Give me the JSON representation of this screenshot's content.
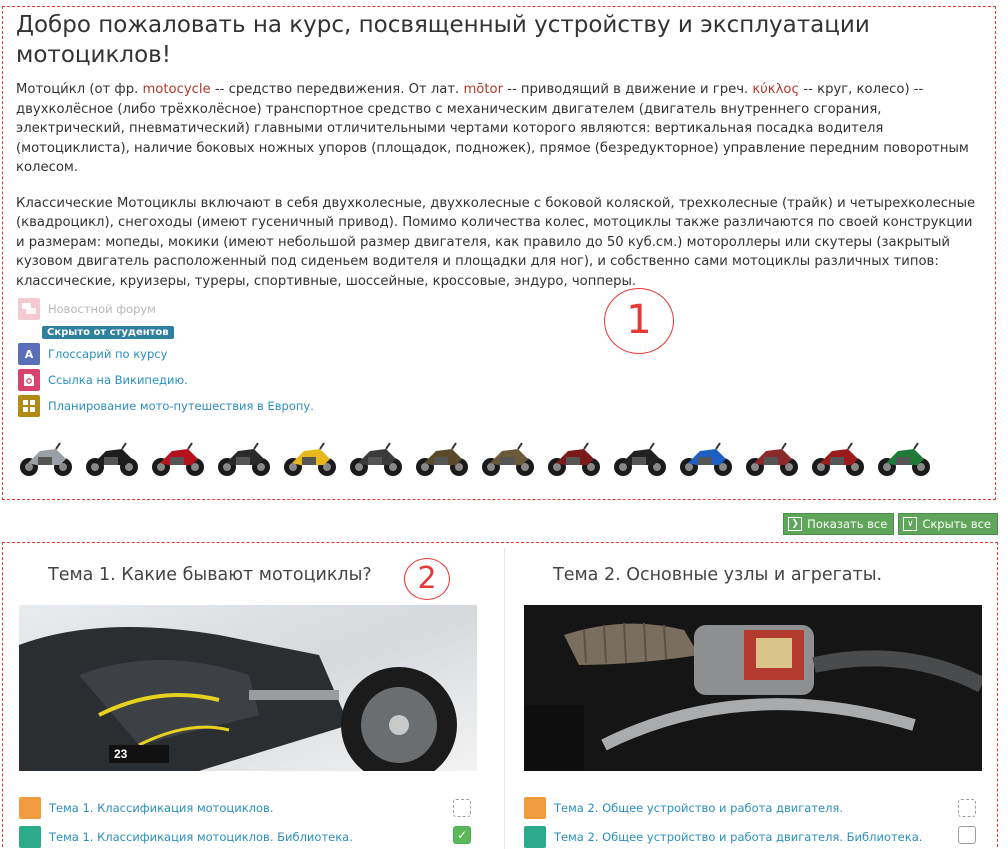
{
  "intro": {
    "title": "Добро пожаловать на курс, посвященный устройству и эксплуатации мотоциклов!",
    "p1_a": "Мотоци́кл (от фр. ",
    "p1_term1": "motocycle",
    "p1_b": " -- средство передвижения. От лат. ",
    "p1_term2": "mōtor",
    "p1_c": " -- приводящий в движение и греч. ",
    "p1_term3": "κύκλος",
    "p1_d": " -- круг, колесо) -- двухколёсное (либо трёхколёсное) транспортное средство с механическим двигателем (двигатель внутреннего сгорания, электрический, пневматический) главными отличительными чертами которого являются: вертикальная посадка водителя (мотоциклиста), наличие боковых ножных упоров (площадок, подножек), прямое (безредукторное) управление передним поворотным колесом.",
    "p2": "Классические Мотоциклы включают в себя двухколесные, двухколесные с боковой коляской, трехколесные (трайк) и четырехколесные (квадроцикл), снегоходы (имеют гусеничный привод). Помимо количества колес, мотоциклы также различаются по своей конструкции и размерам: мопеды, мокики (имеют небольшой размер двигателя, как правило до 50 куб.см.) мотороллеры или скутеры (закрытый кузовом двигатель расположенный под сиденьем водителя и площадки для ног), и собственно сами мотоциклы различных типов: классические, круизеры, туреры, спортивные, шоссейные, кроссовые, эндуро, чопперы."
  },
  "activities": {
    "forum": "Новостной форум",
    "hidden_badge": "Скрыто от студентов",
    "glossary": "Глоссарий по курсу",
    "wiki": "Ссылка на Википедию.",
    "planning": "Планирование мото-путешествия в Европу."
  },
  "annotations": {
    "one": "1",
    "two": "2"
  },
  "tools": {
    "show_all": "Показать все",
    "hide_all": "Скрыть все"
  },
  "topics": [
    {
      "title": "Тема 1. Какие бывают мотоциклы?",
      "items": [
        {
          "label": "Тема 1. Классификация мотоциклов.",
          "completed": false
        },
        {
          "label": "Тема 1. Классификация мотоциклов. Библиотека.",
          "completed": true
        }
      ]
    },
    {
      "title": "Тема 2. Основные узлы и агрегаты.",
      "items": [
        {
          "label": "Тема 2. Общее устройство и работа двигателя.",
          "completed": false
        },
        {
          "label": "Тема 2. Общее устройство и работа двигателя. Библиотека.",
          "completed": false
        }
      ]
    }
  ],
  "colors": {
    "link": "#2a8fbd",
    "accent_green": "#5fa55a",
    "annotation_red": "#e53935",
    "badge_blue": "#2f7fa1"
  },
  "bike_colors": [
    "#9aa0a6",
    "#1d1d1d",
    "#b5121b",
    "#2a2a2a",
    "#e8b81a",
    "#3b3b3b",
    "#5a4a2a",
    "#6b5a3a",
    "#7a1a1a",
    "#222222",
    "#1e5fc2",
    "#8a2a2a",
    "#9a1c1c",
    "#1f7a3a"
  ]
}
